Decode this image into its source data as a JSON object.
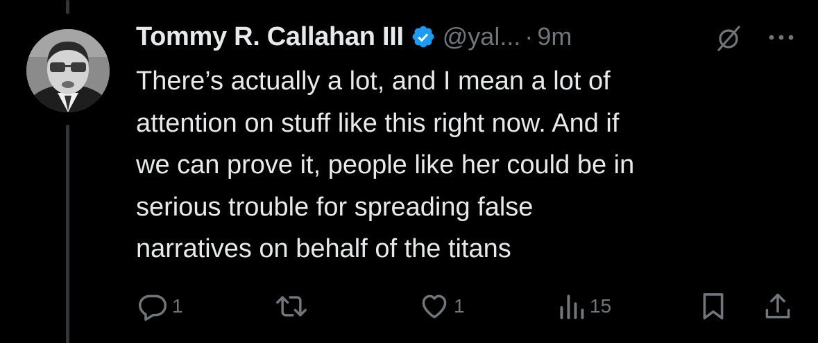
{
  "tweet": {
    "display_name": "Tommy R. Callahan III",
    "verified": true,
    "handle": "@yal...",
    "separator": "·",
    "time": "9m",
    "body_lines": [
      "There’s actually a lot, and I mean a lot of",
      "attention on stuff like this right now. And if",
      "we can prove it, people like her could be in",
      "serious trouble for spreading false",
      "narratives on behalf of the titans"
    ],
    "stats": {
      "replies": "1",
      "retweets": "",
      "likes": "1",
      "views": "15"
    }
  },
  "icons": {
    "avatar": "avatar-photo",
    "verified": "verified-badge-icon",
    "mute": "mute-icon",
    "more": "more-icon",
    "reply": "reply-icon",
    "retweet": "retweet-icon",
    "like": "like-icon",
    "views": "views-icon",
    "bookmark": "bookmark-icon",
    "share": "share-icon"
  },
  "colors": {
    "background": "#000000",
    "text": "#e7e9ea",
    "muted": "#71767b",
    "verified": "#1d9bf0",
    "thread_line": "#333639"
  }
}
